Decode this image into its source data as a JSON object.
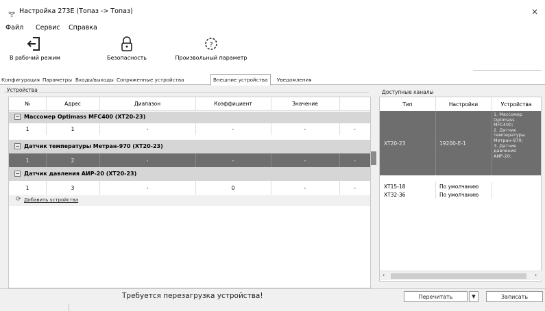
{
  "window": {
    "title": "Настройка 273E (Топаз -> Топаз)",
    "close": "×"
  },
  "menu": [
    "Файл",
    "Сервис",
    "Справка"
  ],
  "toolbar": {
    "home": "В рабочий режим",
    "security": "Безопасность",
    "param": "Произвольный параметр"
  },
  "tabs": [
    "Конфигурация",
    "Параметры",
    "Входы/выходы",
    "Сопряженные устройства",
    "Внешние устройства",
    "Уведомления"
  ],
  "left": {
    "section_label": "Устройства",
    "columns": [
      "№",
      "Адрес",
      "Диапазон",
      "Коэффициент",
      "Значение"
    ],
    "groups": [
      {
        "name": "Массомер Optimass MFC400 (XT20-23)",
        "toggle": "−",
        "row": [
          "1",
          "1",
          "-",
          "-",
          "-",
          "-"
        ]
      },
      {
        "name": "Датчик температуры Метран-970 (XT20-23)",
        "toggle": "−",
        "row": [
          "1",
          "2",
          "-",
          "-",
          "-",
          "-"
        ]
      },
      {
        "name": "Датчик давления АИР-20 (XT20-23)",
        "toggle": "−",
        "row": [
          "1",
          "3",
          "-",
          "0",
          "-",
          "-"
        ]
      }
    ],
    "add_link": "Добавить устройства"
  },
  "right": {
    "section_label": "Доступные каналы",
    "columns": [
      "Тип",
      "Настройки",
      "Устройства"
    ],
    "rows": [
      {
        "type": "XT20-23",
        "settings": "19200-E-1",
        "devices": [
          "1. Массомер",
          "Optimass",
          "MFC400;",
          "2. Датчик",
          "температуры",
          "Метран-970;",
          "3. Датчик",
          "давления",
          "АИР-20;"
        ]
      },
      {
        "type": "XT15-18",
        "settings": "По умолчанию",
        "devices": []
      },
      {
        "type": "XT32-36",
        "settings": "По умолчанию",
        "devices": []
      }
    ]
  },
  "status": "Требуется перезагрузка устройства!",
  "buttons": {
    "read": "Перечитать",
    "write": "Записать"
  }
}
